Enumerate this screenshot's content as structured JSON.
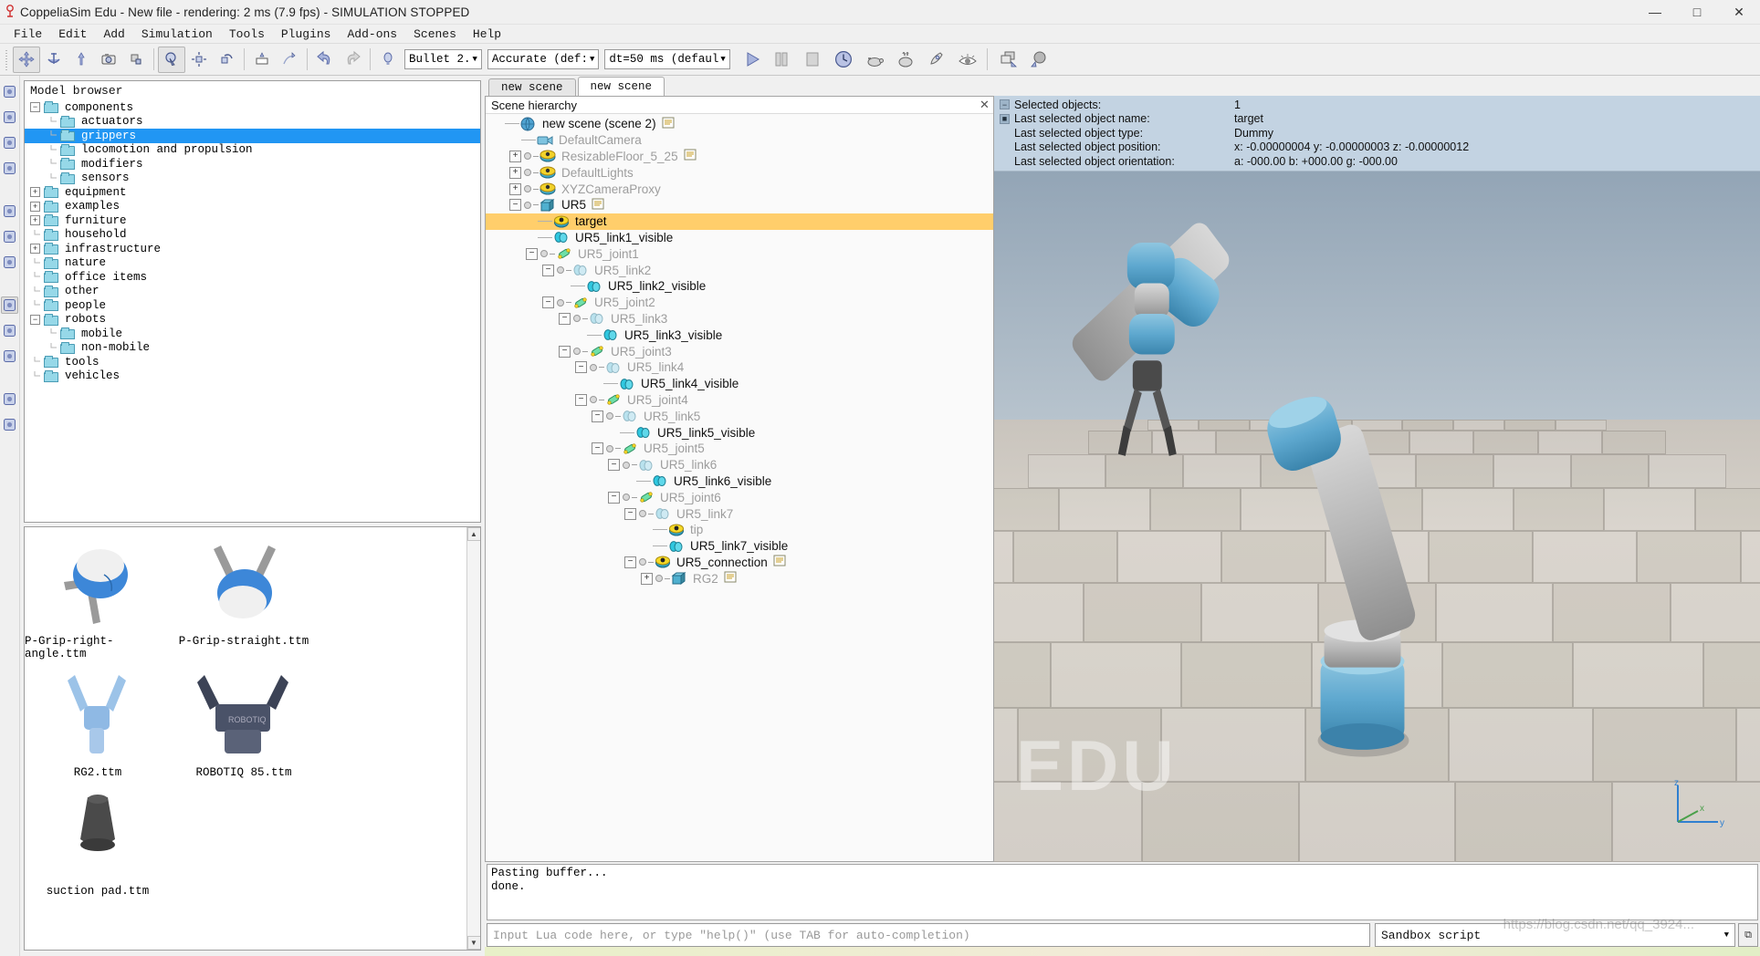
{
  "window": {
    "title": "CoppeliaSim Edu - New file - rendering: 2 ms (7.9 fps) - SIMULATION STOPPED",
    "logo_icon": "coppeliasim-logo-icon",
    "minimize": "—",
    "maximize": "□",
    "close": "✕"
  },
  "menu": {
    "items": [
      {
        "label": "File"
      },
      {
        "label": "Edit"
      },
      {
        "label": "Add"
      },
      {
        "label": "Simulation"
      },
      {
        "label": "Tools"
      },
      {
        "label": "Plugins"
      },
      {
        "label": "Add-ons"
      },
      {
        "label": "Scenes"
      },
      {
        "label": "Help"
      }
    ]
  },
  "toolbar": {
    "buttons": [
      {
        "name": "object-shift-icon",
        "glyph": "✥"
      },
      {
        "name": "object-rotate-icon",
        "glyph": "⚓"
      },
      {
        "name": "object-translate-icon",
        "glyph": "⇧"
      },
      {
        "name": "camera-icon",
        "glyph": "◎"
      },
      {
        "name": "assemble-icon",
        "glyph": "❐"
      },
      {
        "name": "page-selector-icon",
        "glyph": "⌕"
      },
      {
        "name": "object-position-icon",
        "glyph": "⬌"
      },
      {
        "name": "object-orientation-icon",
        "glyph": "↻"
      },
      {
        "name": "collision-icon",
        "glyph": "⬚"
      },
      {
        "name": "path-edit-icon",
        "glyph": "⤳"
      },
      {
        "name": "undo-icon",
        "glyph": "↶"
      },
      {
        "name": "redo-icon",
        "glyph": "↷"
      }
    ],
    "dynamics_engine": "Bullet 2.",
    "engine_accuracy": "Accurate (def:",
    "dt_setting": "dt=50 ms (defaul",
    "transport": [
      {
        "name": "start-simulation-button",
        "glyph": "▶"
      },
      {
        "name": "pause-simulation-button",
        "glyph": "▐▐"
      },
      {
        "name": "stop-simulation-button",
        "glyph": "■"
      }
    ],
    "right_icons": [
      {
        "name": "realtime-clock-icon",
        "glyph": "◴"
      },
      {
        "name": "slow-down-turtle-icon",
        "glyph": "−"
      },
      {
        "name": "speed-up-rabbit-icon",
        "glyph": "+"
      },
      {
        "name": "rocket-thread-icon",
        "glyph": "✈"
      },
      {
        "name": "visibility-eye-icon",
        "glyph": "◉"
      },
      {
        "name": "layers-icon",
        "glyph": "❐"
      },
      {
        "name": "cluster-icon",
        "glyph": "⚫"
      }
    ]
  },
  "rail": {
    "items": [
      {
        "name": "scene-object-properties-icon",
        "glyph": "✻"
      },
      {
        "name": "calculation-modules-icon",
        "glyph": "⌕"
      },
      {
        "name": "dynamics-icon",
        "glyph": "ƒ(x)"
      },
      {
        "name": "user-settings-icon",
        "glyph": "⚙"
      },
      {
        "name": "scripts-icon",
        "glyph": "≡"
      },
      {
        "name": "shape-edit-icon",
        "glyph": "◱"
      },
      {
        "name": "path-icon",
        "glyph": "⤳"
      },
      {
        "name": "model-browser-icon",
        "glyph": "♟"
      },
      {
        "name": "scene-hierarchy-icon",
        "glyph": "≣"
      },
      {
        "name": "layers-stack-icon",
        "glyph": "≣"
      },
      {
        "name": "collection-icon",
        "glyph": "◉"
      },
      {
        "name": "settings-icon",
        "glyph": "⚙"
      }
    ]
  },
  "model_browser": {
    "title": "Model browser",
    "tree": [
      {
        "label": "components",
        "depth": 0,
        "toggle": "minus",
        "selected": false
      },
      {
        "label": "actuators",
        "depth": 1,
        "toggle": "none",
        "selected": false
      },
      {
        "label": "grippers",
        "depth": 1,
        "toggle": "none",
        "selected": true
      },
      {
        "label": "locomotion and propulsion",
        "depth": 1,
        "toggle": "none",
        "selected": false
      },
      {
        "label": "modifiers",
        "depth": 1,
        "toggle": "none",
        "selected": false
      },
      {
        "label": "sensors",
        "depth": 1,
        "toggle": "none",
        "selected": false
      },
      {
        "label": "equipment",
        "depth": 0,
        "toggle": "plus",
        "selected": false
      },
      {
        "label": "examples",
        "depth": 0,
        "toggle": "plus",
        "selected": false
      },
      {
        "label": "furniture",
        "depth": 0,
        "toggle": "plus",
        "selected": false
      },
      {
        "label": "household",
        "depth": 0,
        "toggle": "none",
        "selected": false
      },
      {
        "label": "infrastructure",
        "depth": 0,
        "toggle": "plus",
        "selected": false
      },
      {
        "label": "nature",
        "depth": 0,
        "toggle": "none",
        "selected": false
      },
      {
        "label": "office items",
        "depth": 0,
        "toggle": "none",
        "selected": false
      },
      {
        "label": "other",
        "depth": 0,
        "toggle": "none",
        "selected": false
      },
      {
        "label": "people",
        "depth": 0,
        "toggle": "none",
        "selected": false
      },
      {
        "label": "robots",
        "depth": 0,
        "toggle": "minus",
        "selected": false
      },
      {
        "label": "mobile",
        "depth": 1,
        "toggle": "none",
        "selected": false
      },
      {
        "label": "non-mobile",
        "depth": 1,
        "toggle": "none",
        "selected": false
      },
      {
        "label": "tools",
        "depth": 0,
        "toggle": "none",
        "selected": false
      },
      {
        "label": "vehicles",
        "depth": 0,
        "toggle": "none",
        "selected": false
      }
    ]
  },
  "model_thumbnails": {
    "items": [
      {
        "caption": "P-Grip-right-angle.ttm",
        "icon": "gripper-right-angle-thumbnail"
      },
      {
        "caption": "P-Grip-straight.ttm",
        "icon": "gripper-straight-thumbnail"
      },
      {
        "caption": "RG2.ttm",
        "icon": "rg2-gripper-thumbnail"
      },
      {
        "caption": "ROBOTIQ 85.ttm",
        "icon": "robotiq85-gripper-thumbnail"
      },
      {
        "caption": "suction pad.ttm",
        "icon": "suction-pad-thumbnail"
      }
    ],
    "scroll_up": "▲",
    "scroll_down": "▼"
  },
  "scene_tabs": [
    {
      "label": "new scene",
      "active": false
    },
    {
      "label": "new scene",
      "active": true
    }
  ],
  "hierarchy": {
    "title": "Scene hierarchy",
    "close_glyph": "✕",
    "nodes": [
      {
        "label": "new scene (scene 2)",
        "depth": 0,
        "toggle": "none",
        "icon": "scene-globe-icon",
        "dim": false,
        "selected": false,
        "script": true
      },
      {
        "label": "DefaultCamera",
        "depth": 1,
        "toggle": "none",
        "icon": "camera-icon",
        "dim": true,
        "selected": false,
        "script": false
      },
      {
        "label": "ResizableFloor_5_25",
        "depth": 1,
        "toggle": "plus",
        "icon": "shape-icon",
        "dim": true,
        "selected": false,
        "script": true
      },
      {
        "label": "DefaultLights",
        "depth": 1,
        "toggle": "plus",
        "icon": "shape-icon",
        "dim": true,
        "selected": false,
        "script": false
      },
      {
        "label": "XYZCameraProxy",
        "depth": 1,
        "toggle": "plus",
        "icon": "shape-icon",
        "dim": true,
        "selected": false,
        "script": false
      },
      {
        "label": "UR5",
        "depth": 1,
        "toggle": "minus",
        "icon": "model-icon",
        "dim": false,
        "selected": false,
        "script": true
      },
      {
        "label": "target",
        "depth": 2,
        "toggle": "none",
        "icon": "dummy-icon",
        "dim": false,
        "selected": true,
        "script": false
      },
      {
        "label": "UR5_link1_visible",
        "depth": 2,
        "toggle": "none",
        "icon": "link-icon",
        "dim": false,
        "selected": false,
        "script": false
      },
      {
        "label": "UR5_joint1",
        "depth": 2,
        "toggle": "minus",
        "icon": "joint-icon",
        "dim": true,
        "selected": false,
        "script": false
      },
      {
        "label": "UR5_link2",
        "depth": 3,
        "toggle": "minus",
        "icon": "link-icon-dim",
        "dim": true,
        "selected": false,
        "script": false
      },
      {
        "label": "UR5_link2_visible",
        "depth": 4,
        "toggle": "none",
        "icon": "link-icon",
        "dim": false,
        "selected": false,
        "script": false
      },
      {
        "label": "UR5_joint2",
        "depth": 3,
        "toggle": "minus",
        "icon": "joint-icon",
        "dim": true,
        "selected": false,
        "script": false
      },
      {
        "label": "UR5_link3",
        "depth": 4,
        "toggle": "minus",
        "icon": "link-icon-dim",
        "dim": true,
        "selected": false,
        "script": false
      },
      {
        "label": "UR5_link3_visible",
        "depth": 5,
        "toggle": "none",
        "icon": "link-icon",
        "dim": false,
        "selected": false,
        "script": false
      },
      {
        "label": "UR5_joint3",
        "depth": 4,
        "toggle": "minus",
        "icon": "joint-icon",
        "dim": true,
        "selected": false,
        "script": false
      },
      {
        "label": "UR5_link4",
        "depth": 5,
        "toggle": "minus",
        "icon": "link-icon-dim",
        "dim": true,
        "selected": false,
        "script": false
      },
      {
        "label": "UR5_link4_visible",
        "depth": 6,
        "toggle": "none",
        "icon": "link-icon",
        "dim": false,
        "selected": false,
        "script": false
      },
      {
        "label": "UR5_joint4",
        "depth": 5,
        "toggle": "minus",
        "icon": "joint-icon",
        "dim": true,
        "selected": false,
        "script": false
      },
      {
        "label": "UR5_link5",
        "depth": 6,
        "toggle": "minus",
        "icon": "link-icon-dim",
        "dim": true,
        "selected": false,
        "script": false
      },
      {
        "label": "UR5_link5_visible",
        "depth": 7,
        "toggle": "none",
        "icon": "link-icon",
        "dim": false,
        "selected": false,
        "script": false
      },
      {
        "label": "UR5_joint5",
        "depth": 6,
        "toggle": "minus",
        "icon": "joint-icon",
        "dim": true,
        "selected": false,
        "script": false
      },
      {
        "label": "UR5_link6",
        "depth": 7,
        "toggle": "minus",
        "icon": "link-icon-dim",
        "dim": true,
        "selected": false,
        "script": false
      },
      {
        "label": "UR5_link6_visible",
        "depth": 8,
        "toggle": "none",
        "icon": "link-icon",
        "dim": false,
        "selected": false,
        "script": false
      },
      {
        "label": "UR5_joint6",
        "depth": 7,
        "toggle": "minus",
        "icon": "joint-icon",
        "dim": true,
        "selected": false,
        "script": false
      },
      {
        "label": "UR5_link7",
        "depth": 8,
        "toggle": "minus",
        "icon": "link-icon-dim",
        "dim": true,
        "selected": false,
        "script": false
      },
      {
        "label": "tip",
        "depth": 9,
        "toggle": "none",
        "icon": "dummy-icon",
        "dim": true,
        "selected": false,
        "script": false
      },
      {
        "label": "UR5_link7_visible",
        "depth": 9,
        "toggle": "none",
        "icon": "link-icon",
        "dim": false,
        "selected": false,
        "script": false
      },
      {
        "label": "UR5_connection",
        "depth": 8,
        "toggle": "minus",
        "icon": "dummy-icon",
        "dim": false,
        "selected": false,
        "script": true
      },
      {
        "label": "RG2",
        "depth": 9,
        "toggle": "plus",
        "icon": "model-icon",
        "dim": true,
        "selected": false,
        "script": true
      }
    ]
  },
  "info_panel": {
    "rows": [
      {
        "key": "Selected objects:",
        "value": "1",
        "checkbox": "minus"
      },
      {
        "key": "Last selected object name:",
        "value": "target",
        "checkbox": "square"
      },
      {
        "key": "Last selected object type:",
        "value": "Dummy",
        "checkbox": "none"
      },
      {
        "key": "Last selected object position:",
        "value": "x: -0.00000004   y: -0.00000003   z: -0.00000012",
        "checkbox": "none"
      },
      {
        "key": "Last selected object orientation:",
        "value": "a: -000.00   b: +000.00   g: -000.00",
        "checkbox": "none"
      }
    ]
  },
  "scene_view": {
    "watermark": "EDU",
    "axis_labels": {
      "x": "x",
      "y": "y",
      "z": "z"
    }
  },
  "console": {
    "lines": [
      "Pasting buffer...",
      "done."
    ]
  },
  "lua_input": {
    "placeholder": "Input Lua code here, or type \"help()\" (use TAB for auto-completion)",
    "value": ""
  },
  "script_selector": {
    "value": "Sandbox script",
    "caret": "▼",
    "popout_glyph": "⧉"
  },
  "watermark_url": "https://blog.csdn.net/qq_3924...",
  "colors": {
    "selection_blue": "#2196f3",
    "selection_orange": "#ffce6b",
    "info_bg": "#c3d3e2",
    "toolbar_bg": "#f0f0f0"
  }
}
